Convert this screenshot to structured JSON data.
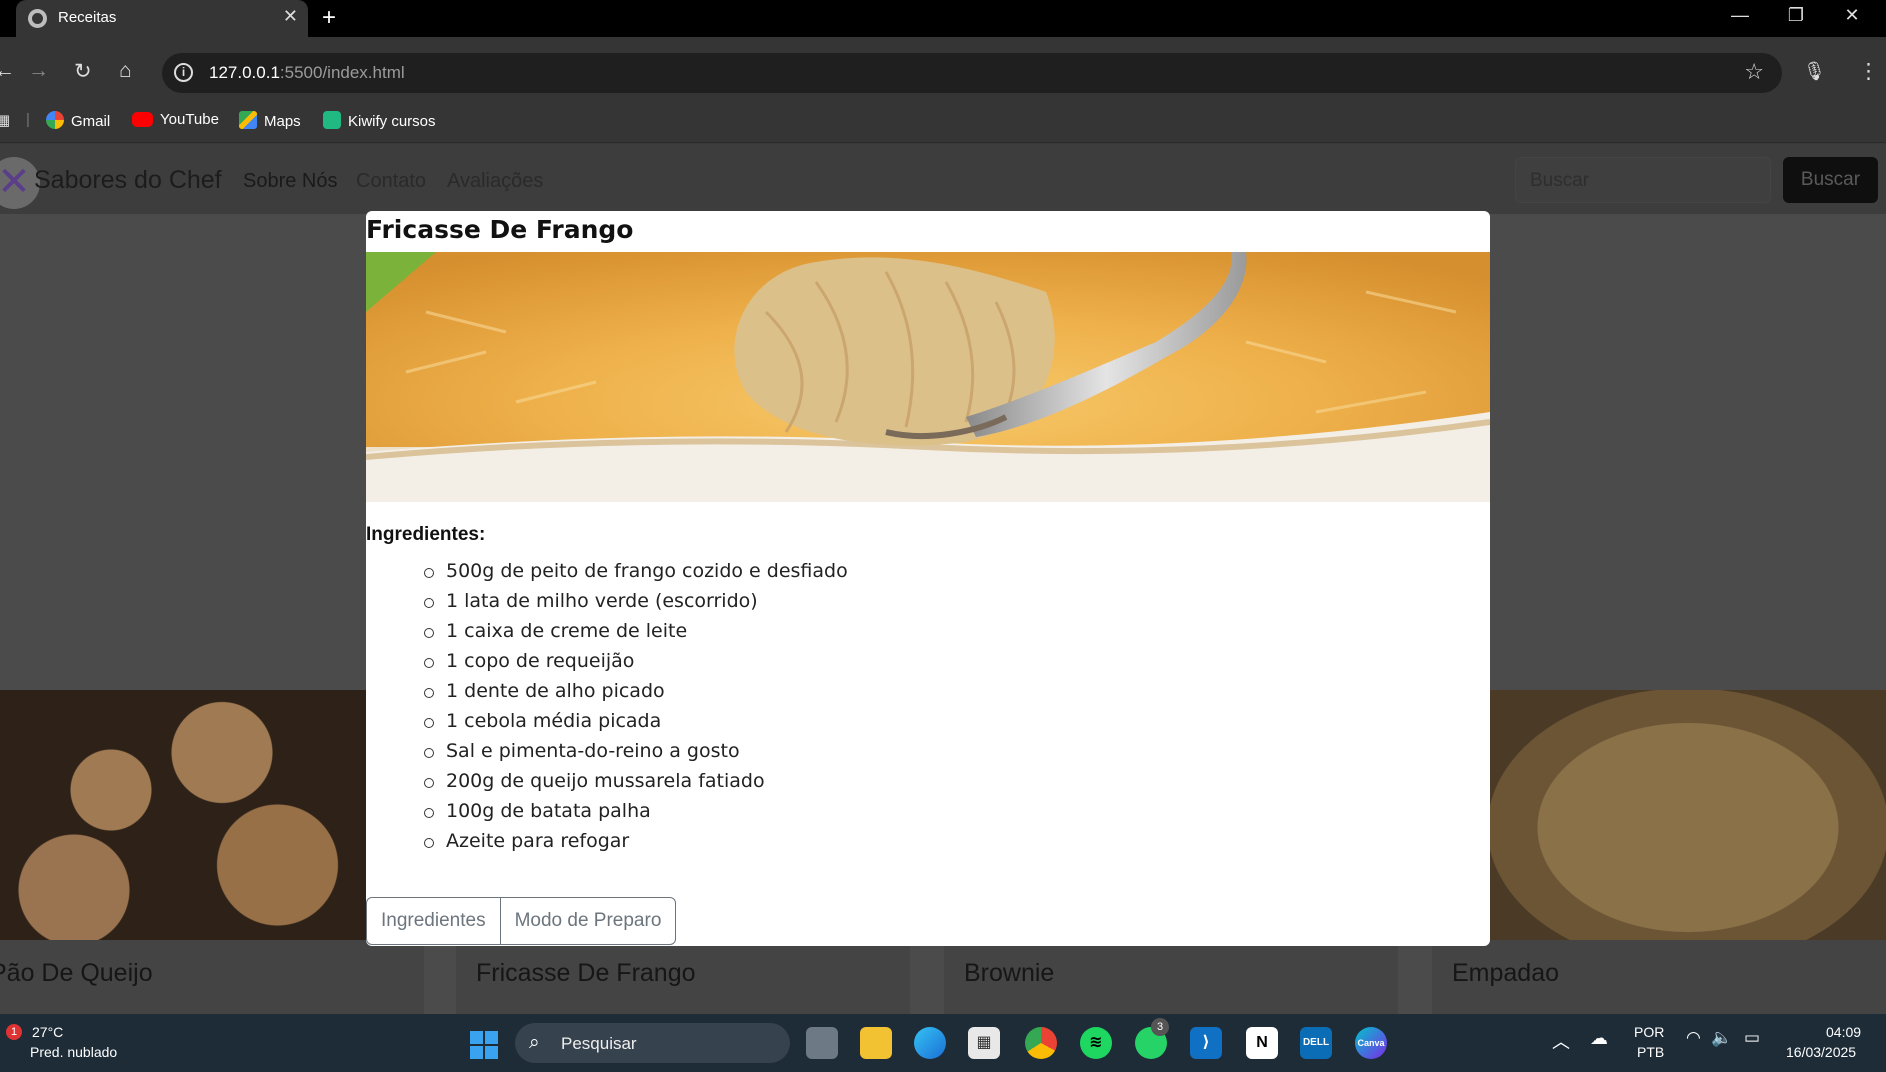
{
  "browser": {
    "tab_title": "Receitas",
    "url_host": "127.0.0.1",
    "url_path": ":5500/index.html",
    "bookmarks": [
      "Gmail",
      "YouTube",
      "Maps",
      "Kiwify cursos"
    ]
  },
  "site": {
    "brand": "Sabores do Chef",
    "nav_links": [
      "Sobre Nós",
      "Contato",
      "Avaliações"
    ],
    "search_placeholder": "Buscar",
    "search_button": "Buscar",
    "cards": [
      "Pão De Queijo",
      "Fricasse De Frango",
      "Brownie",
      "Empadao"
    ]
  },
  "modal": {
    "title": "Fricasse De Frango",
    "ingredients_heading": "Ingredientes:",
    "ingredients": [
      "500g de peito de frango cozido e desfiado",
      "1 lata de milho verde (escorrido)",
      "1 caixa de creme de leite",
      "1 copo de requeijão",
      "1 dente de alho picado",
      "1 cebola média picada",
      "Sal e pimenta-do-reino a gosto",
      "200g de queijo mussarela fatiado",
      "100g de batata palha",
      "Azeite para refogar"
    ],
    "tab_ingredients": "Ingredientes",
    "tab_preparo": "Modo de Preparo"
  },
  "taskbar": {
    "temperature": "27°C",
    "weather": "Pred. nublado",
    "weather_badge": "1",
    "search_label": "Pesquisar",
    "whatsapp_badge": "3",
    "lang_1": "POR",
    "lang_2": "PTB",
    "time": "04:09",
    "date": "16/03/2025"
  }
}
